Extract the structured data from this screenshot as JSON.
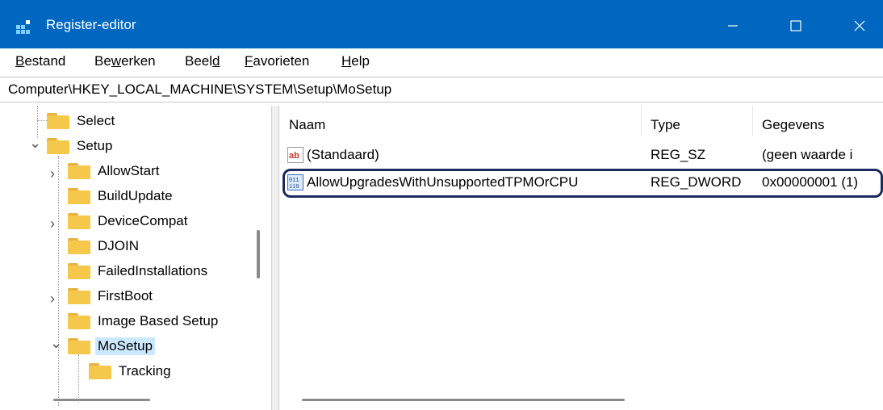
{
  "window": {
    "title": "Register-editor",
    "controls": {
      "minimize": "—",
      "maximize": "☐",
      "close": "✕"
    }
  },
  "menu": [
    {
      "label": "Bestand",
      "underline_index": 0
    },
    {
      "label": "Bewerken",
      "underline_index": 2
    },
    {
      "label": "Beeld",
      "underline_index": 4
    },
    {
      "label": "Favorieten",
      "underline_index": 0
    },
    {
      "label": "Help",
      "underline_index": 0
    }
  ],
  "address": "Computer\\HKEY_LOCAL_MACHINE\\SYSTEM\\Setup\\MoSetup",
  "tree": [
    {
      "label": "Select",
      "expander": "none",
      "selected": false
    },
    {
      "label": "Setup",
      "expander": "expanded",
      "selected": false
    },
    {
      "label": "AllowStart",
      "expander": "collapsed",
      "selected": false
    },
    {
      "label": "BuildUpdate",
      "expander": "none",
      "selected": false
    },
    {
      "label": "DeviceCompat",
      "expander": "collapsed",
      "selected": false
    },
    {
      "label": "DJOIN",
      "expander": "none",
      "selected": false
    },
    {
      "label": "FailedInstallations",
      "expander": "none",
      "selected": false
    },
    {
      "label": "FirstBoot",
      "expander": "collapsed",
      "selected": false
    },
    {
      "label": "Image Based Setup",
      "expander": "none",
      "selected": false
    },
    {
      "label": "MoSetup",
      "expander": "expanded",
      "selected": true
    },
    {
      "label": "Tracking",
      "expander": "none",
      "selected": false
    }
  ],
  "list": {
    "columns": [
      "Naam",
      "Type",
      "Gegevens"
    ],
    "rows": [
      {
        "icon": "string-value-icon",
        "name": "(Standaard)",
        "type": "REG_SZ",
        "data": "(geen waarde i"
      },
      {
        "icon": "dword-value-icon",
        "name": "AllowUpgradesWithUnsupportedTPMOrCPU",
        "type": "REG_DWORD",
        "data": "0x00000001 (1)"
      }
    ]
  },
  "colors": {
    "titlebar": "#0067c0",
    "selection": "#cce8ff",
    "highlight_border": "#1b2a5e"
  }
}
